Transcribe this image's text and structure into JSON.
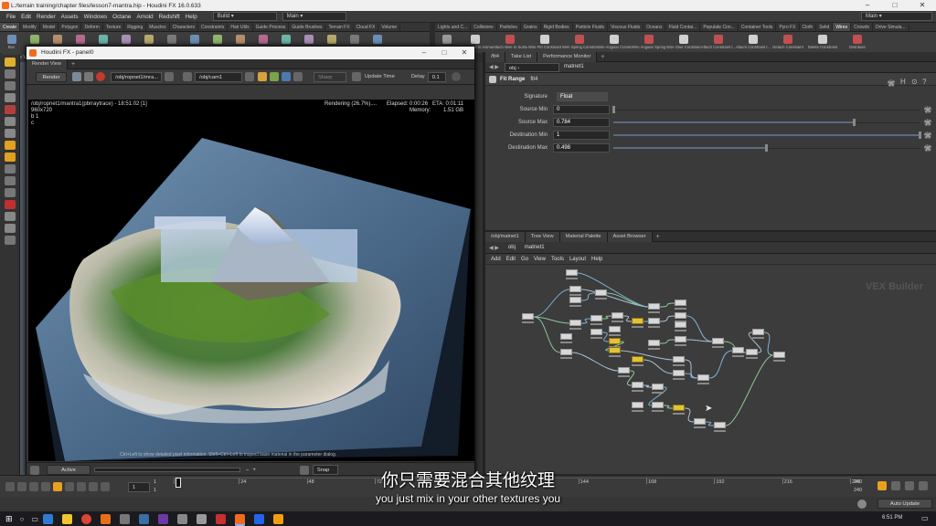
{
  "window": {
    "title": "L:/terrain training/chapter files/lesson7-mantra.hip - Houdini FX 16.0.633"
  },
  "menubar": {
    "items": [
      "File",
      "Edit",
      "Render",
      "Assets",
      "Windows",
      "Octane",
      "Arnold",
      "Redshift",
      "Help"
    ],
    "build_desktop": "Build",
    "main_desktop": "Main",
    "right_desktop": "Main"
  },
  "shelf_left": {
    "tabs": [
      "Create",
      "Modify",
      "Model",
      "Polygon",
      "Deform",
      "Texture",
      "Rigging",
      "Muscles",
      "Characters",
      "Constraints",
      "Hair Utils",
      "Guide Process",
      "Guide Brushes",
      "Terrain FX",
      "Cloud FX",
      "Volume"
    ],
    "tools": [
      "Box",
      "Sphere",
      "Tube",
      "Torus",
      "Grid",
      "Null",
      "Line",
      "Circle",
      "Curve",
      "Draw Curve",
      "Path",
      "Spray Paint",
      "Font",
      "Platonic Solids",
      "L-System",
      "Metaball",
      "File"
    ],
    "scene_view_tab": "Scene View"
  },
  "shelf_right": {
    "tabs": [
      "Lights and C...",
      "Collisions",
      "Particles",
      "Grains",
      "Rigid Bodies",
      "Particle Fluids",
      "Viscous Fluids",
      "Oceans",
      "Fluid Contai...",
      "Populate Con...",
      "Container Tools",
      "Pyro FX",
      "Cloth",
      "Solid",
      "Wires",
      "Crowds",
      "Drive Simula..."
    ],
    "tools": [
      "Glue Wires to Animation",
      "Attach Wire to Surface",
      "Wire Pin Constraint",
      "Wire Spring Constraint",
      "Wire Angular Constraint",
      "Wire Angular Spring Cons.",
      "Wire Glue Constraint",
      "Attach Constraint t...",
      "Attach Constraint t...",
      "Detach Constraint",
      "Delete Constraint",
      "Distribute"
    ],
    "first_tool": "Glue Pose"
  },
  "render_panel": {
    "window_title": "Houdini FX - panel0",
    "tab": "Render View",
    "render_button": "Render",
    "rop_path": "/obj/ropnet1/mra...",
    "camera_path": "/obj/cam1",
    "sharp_label": "Sharp",
    "update_time": "Update Time",
    "delay_label": "Delay",
    "delay_value": "0.1",
    "overlay_path": "/obj/ropnet1/mantra1(pbrraytrace) - 18:51:02 [1]",
    "resolution": "960x720",
    "overlay_b": "b 1",
    "overlay_c": "c",
    "rendering_status": "Rendering (26.7%)....",
    "elapsed": "Elapsed: 0:00:26",
    "eta": "ETA: 0:01:11",
    "memory_label": "Memory:",
    "memory_value": "1.51 GB",
    "hint": "Ctrl+Left to show detailed pixel information. Shift+Ctrl+Left to inspect base material in the parameter dialog.",
    "active_render": "Active Render",
    "snap_label": "Snap",
    "snap_value": "2"
  },
  "param_pane": {
    "tabs": [
      "/fit4",
      "Take List",
      "Performance Monitor"
    ],
    "path_obj": "obj",
    "path_net": "matnet1",
    "node_type": "Fit Range",
    "node_name": "fit4",
    "params": [
      {
        "label": "Signature",
        "value": "Float"
      },
      {
        "label": "Source Min",
        "value": "0",
        "level": 0.0
      },
      {
        "label": "Source Max",
        "value": "0.784",
        "level": 0.784
      },
      {
        "label": "Destination Min",
        "value": "1",
        "level": 1.0
      },
      {
        "label": "Destination Max",
        "value": "0.498",
        "level": 0.498
      }
    ]
  },
  "network_pane": {
    "tabs": [
      "/obj/matnet1",
      "Tree View",
      "Material Palette",
      "Asset Browser"
    ],
    "path_obj": "obj",
    "path_net": "matnet1",
    "menu": [
      "Add",
      "Edit",
      "Go",
      "View",
      "Tools",
      "Layout",
      "Help"
    ],
    "watermark": "VEX Builder"
  },
  "timeline": {
    "frame": "1",
    "start_a": "1",
    "start_b": "1",
    "ticks": [
      "1",
      "24",
      "48",
      "72",
      "96",
      "120",
      "144",
      "168",
      "192",
      "216",
      "240"
    ],
    "end_a": "240",
    "end_b": "240",
    "auto_update": "Auto Update"
  },
  "taskbar": {
    "time": "6:51 PM"
  },
  "subtitles": {
    "zh": "你只需要混合其他纹理",
    "en": "you just mix in your other textures you"
  },
  "colors": {
    "accent_yellow": "#e2c23a",
    "timeline_playhead": "#f0a500",
    "bg": "#3a3a3a"
  }
}
